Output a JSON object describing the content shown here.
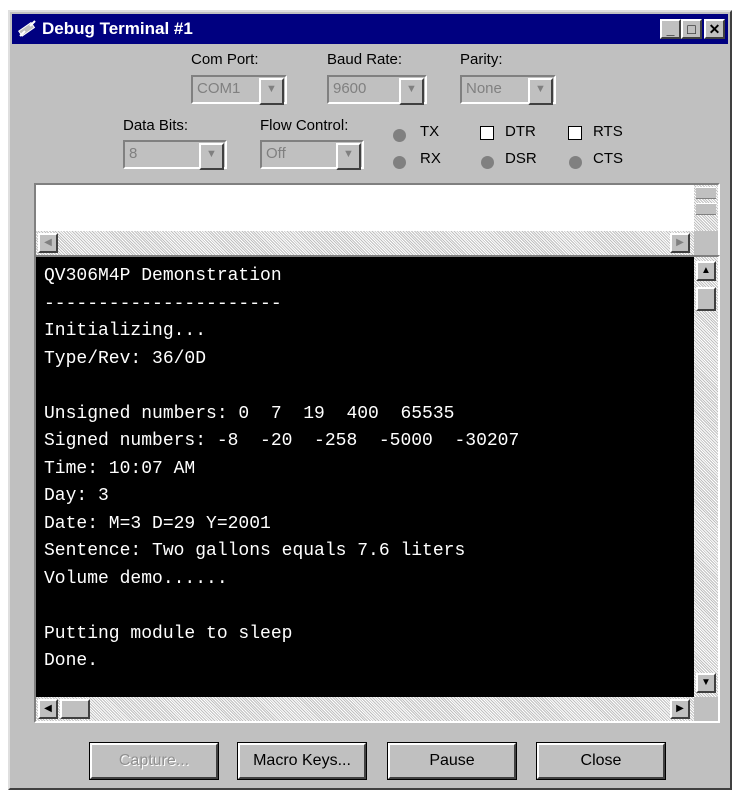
{
  "window": {
    "title": "Debug Terminal #1"
  },
  "titlebar_buttons": {
    "minimize": "_",
    "maximize": "□",
    "close": "✕"
  },
  "settings": {
    "com_port": {
      "label": "Com Port:",
      "value": "COM1"
    },
    "baud_rate": {
      "label": "Baud Rate:",
      "value": "9600"
    },
    "parity": {
      "label": "Parity:",
      "value": "None"
    },
    "data_bits": {
      "label": "Data Bits:",
      "value": "8"
    },
    "flow_control": {
      "label": "Flow Control:",
      "value": "Off"
    }
  },
  "indicators": {
    "tx": "TX",
    "rx": "RX",
    "dsr": "DSR",
    "cts": "CTS"
  },
  "checkboxes": {
    "dtr": {
      "label": "DTR",
      "checked": false
    },
    "rts": {
      "label": "RTS",
      "checked": false
    }
  },
  "transmit": {
    "value": ""
  },
  "receive": {
    "lines": [
      "QV306M4P Demonstration",
      "----------------------",
      "Initializing...",
      "Type/Rev: 36/0D",
      "",
      "Unsigned numbers: 0  7  19  400  65535",
      "Signed numbers: -8  -20  -258  -5000  -30207",
      "Time: 10:07 AM",
      "Day: 3",
      "Date: M=3 D=29 Y=2001",
      "Sentence: Two gallons equals 7.6 liters",
      "Volume demo......",
      "",
      "Putting module to sleep",
      "Done."
    ]
  },
  "buttons": {
    "capture": "Capture...",
    "macro_keys": "Macro Keys...",
    "pause": "Pause",
    "close": "Close"
  },
  "icons": {
    "app": "stamp-plug-icon",
    "dropdown": "chevron-down-icon",
    "scroll_up": "arrow-up-icon",
    "scroll_down": "arrow-down-icon",
    "scroll_left": "arrow-left-icon",
    "scroll_right": "arrow-right-icon"
  },
  "colors": {
    "titlebar": "#000080",
    "face": "#c0c0c0",
    "led_off": "#808080",
    "console_bg": "#000000",
    "console_text": "#ffffff"
  }
}
